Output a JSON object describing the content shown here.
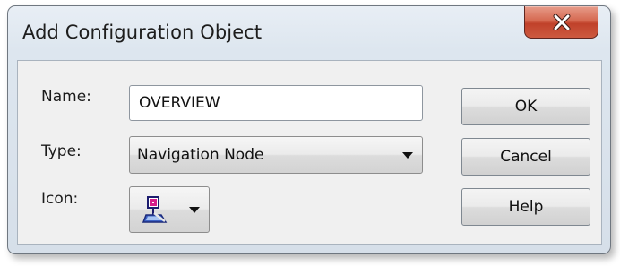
{
  "dialog": {
    "title": "Add Configuration Object",
    "close_icon": "close-x-icon"
  },
  "form": {
    "name_label": "Name:",
    "name_value": "OVERVIEW",
    "type_label": "Type:",
    "type_value": "Navigation Node",
    "icon_label": "Icon:",
    "icon_selected": "navigation-node-icon"
  },
  "buttons": {
    "ok": "OK",
    "cancel": "Cancel",
    "help": "Help"
  },
  "colors": {
    "close_button": "#c7452e",
    "client_background": "#f0f0f0",
    "icon_accent": "#d61c8a"
  }
}
